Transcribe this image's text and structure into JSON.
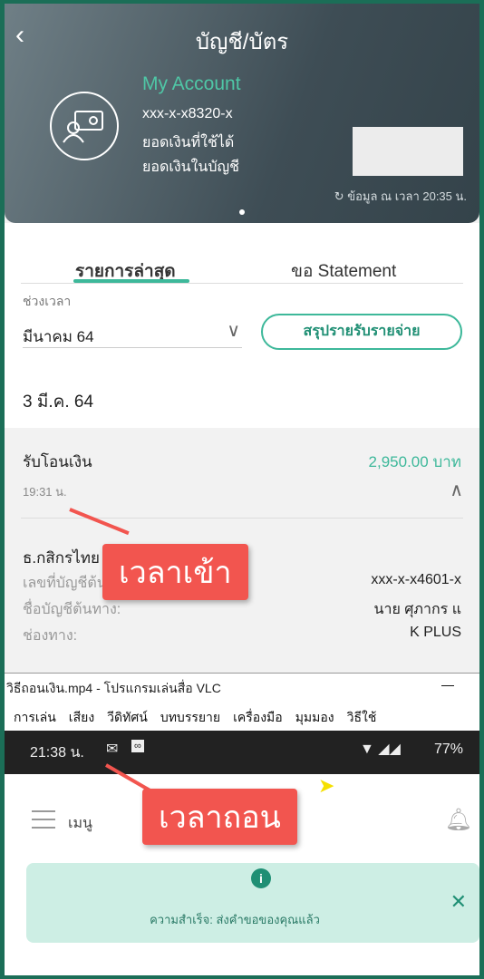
{
  "header": {
    "title": "บัญชี/บัตร",
    "account_name": "My Account",
    "account_number": "xxx-x-x8320-x",
    "available_label": "ยอดเงินที่ใช้ได้",
    "balance_label": "ยอดเงินในบัญชี",
    "updated": "ข้อมูล ณ เวลา 20:35 น."
  },
  "tabs": [
    {
      "label": "รายการล่าสุด",
      "active": true
    },
    {
      "label": "ขอ Statement",
      "active": false
    }
  ],
  "filter": {
    "period_label": "ช่วงเวลา",
    "period_value": "มีนาคม 64",
    "summary_button": "สรุปรายรับรายจ่าย"
  },
  "date": "3 มี.ค. 64",
  "transaction": {
    "title": "รับโอนเงิน",
    "amount": "2,950.00 บาท",
    "time": "19:31 น.",
    "bank": "ธ.กสิกรไทย",
    "details": [
      {
        "label": "เลขที่บัญชีต้นทาง:",
        "value": "xxx-x-x4601-x"
      },
      {
        "label": "ชื่อบัญชีต้นทาง:",
        "value": "นาย ศุภากร แ"
      },
      {
        "label": "ช่องทาง:",
        "value": "K PLUS"
      }
    ]
  },
  "callouts": {
    "in": "เวลาเข้า",
    "out": "เวลาถอน"
  },
  "vlc": {
    "title": "วิธีถอนเงิน.mp4 - โปรแกรมเล่นสื่อ VLC",
    "menu": [
      "การเล่น",
      "เสียง",
      "วีดิทัศน์",
      "บทบรรยาย",
      "เครื่องมือ",
      "มุมมอง",
      "วิธีใช้"
    ]
  },
  "phone": {
    "time": "21:38 น.",
    "battery": "77%",
    "menu_label": "เมนู",
    "toast": "ความสำเร็จ: ส่งคำขอของคุณแล้ว"
  },
  "colors": {
    "accent": "#3db89a",
    "callout": "#f2554f",
    "frame": "#1b6e57"
  }
}
